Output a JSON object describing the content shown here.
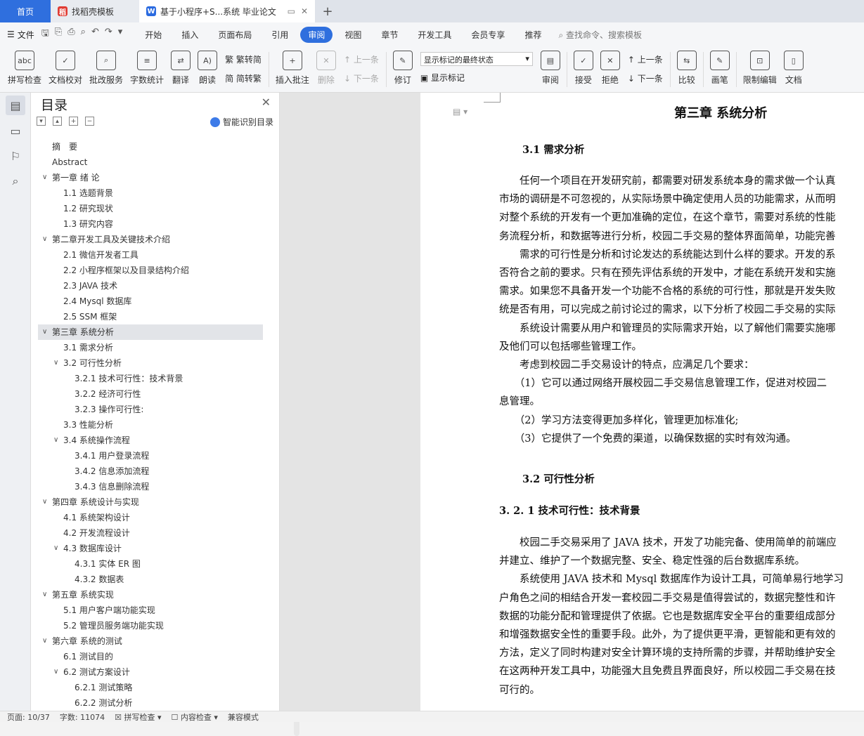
{
  "tabs": {
    "home": "首页",
    "templates": "找稻壳模板",
    "doc": "基于小程序+S...系统 毕业论文"
  },
  "menu": {
    "file": "文件",
    "items": [
      "开始",
      "插入",
      "页面布局",
      "引用",
      "审阅",
      "视图",
      "章节",
      "开发工具",
      "会员专享",
      "推荐"
    ],
    "search": "查找命令、搜索模板"
  },
  "ribbon": {
    "spell_icon": "abc",
    "spell": "拼写检查",
    "proof": "文档校对",
    "batch": "批改服务",
    "count": "字数统计",
    "translate": "翻译",
    "read": "朗读",
    "trad": "繁转简",
    "simp": "简转繁",
    "insert_comment": "插入批注",
    "delete": "删除",
    "prev": "上一条",
    "next": "下一条",
    "track": "修订",
    "markup_select": "显示标记的最终状态",
    "show_markup": "显示标记",
    "review": "审阅",
    "accept": "接受",
    "reject": "拒绝",
    "prev2": "上一条",
    "next2": "下一条",
    "compare": "比较",
    "pen": "画笔",
    "restrict": "限制编辑",
    "doc_right": "文档"
  },
  "toc": {
    "title": "目录",
    "smart": "智能识别目录",
    "items": [
      {
        "text": "摘　要",
        "level": 1
      },
      {
        "text": "Abstract",
        "level": 1
      },
      {
        "text": "第一章  绪  论",
        "level": 1
      },
      {
        "text": "1.1 选题背景",
        "level": 2
      },
      {
        "text": "1.2 研究现状",
        "level": 2
      },
      {
        "text": "1.3 研究内容",
        "level": 2
      },
      {
        "text": "第二章开发工具及关键技术介绍",
        "level": 1
      },
      {
        "text": "2.1 微信开发者工具",
        "level": 2
      },
      {
        "text": "2.2 小程序框架以及目录结构介绍",
        "level": 2
      },
      {
        "text": "2.3 JAVA 技术",
        "level": 2
      },
      {
        "text": "2.4    Mysql 数据库",
        "level": 2
      },
      {
        "text": "2.5 SSM 框架",
        "level": 2
      },
      {
        "text": "第三章  系统分析",
        "level": 1
      },
      {
        "text": "3.1 需求分析",
        "level": 2
      },
      {
        "text": "3.2 可行性分析",
        "level": 2
      },
      {
        "text": "3.2.1 技术可行性：技术背景",
        "level": 3
      },
      {
        "text": "3.2.2 经济可行性",
        "level": 3
      },
      {
        "text": "3.2.3 操作可行性:",
        "level": 3
      },
      {
        "text": "3.3 性能分析",
        "level": 2
      },
      {
        "text": "3.4 系统操作流程",
        "level": 2
      },
      {
        "text": "3.4.1 用户登录流程",
        "level": 3
      },
      {
        "text": "3.4.2 信息添加流程",
        "level": 3
      },
      {
        "text": "3.4.3 信息删除流程",
        "level": 3
      },
      {
        "text": "第四章  系统设计与实现",
        "level": 1
      },
      {
        "text": "4.1 系统架构设计",
        "level": 2
      },
      {
        "text": "4.2 开发流程设计",
        "level": 2
      },
      {
        "text": "4.3 数据库设计",
        "level": 2
      },
      {
        "text": "4.3.1 实体 ER 图",
        "level": 3
      },
      {
        "text": "4.3.2 数据表",
        "level": 3
      },
      {
        "text": "第五章  系统实现",
        "level": 1
      },
      {
        "text": "5.1 用户客户端功能实现",
        "level": 2
      },
      {
        "text": "5.2  管理员服务端功能实现",
        "level": 2
      },
      {
        "text": "第六章    系统的测试",
        "level": 1
      },
      {
        "text": "6.1  测试目的",
        "level": 2
      },
      {
        "text": "6.2  测试方案设计",
        "level": 2
      },
      {
        "text": "6.2.1  测试策略",
        "level": 3
      },
      {
        "text": "6.2.2  测试分析",
        "level": 3
      }
    ]
  },
  "page": {
    "chapter": "第三章  系统分析",
    "s31": "3.1 需求分析",
    "lines": [
      "　　任何一个项目在开发研究前，都需要对研发系统本身的需求做一个认真",
      "市场的调研是不可忽视的，从实际场景中确定使用人员的功能需求，从而明",
      "对整个系统的开发有一个更加准确的定位，在这个章节，需要对系统的性能",
      "务流程分析，和数据等进行分析，校园二手交易的整体界面简单，功能完善",
      "　　需求的可行性是分析和讨论发达的系统能达到什么样的要求。开发的系",
      "否符合之前的要求。只有在预先评估系统的开发中，才能在系统开发和实施",
      "需求。如果您不具备开发一个功能不合格的系统的可行性，那就是开发失败",
      "统是否有用，可以完成之前讨论过的需求，以下分析了校园二手交易的实际",
      "　　系统设计需要从用户和管理员的实际需求开始，以了解他们需要实施哪",
      "及他们可以包括哪些管理工作。",
      "　　考虑到校园二手交易设计的特点，应满足几个要求：",
      "　　（1）它可以通过网络开展校园二手交易信息管理工作，促进对校园二",
      "息管理。",
      "　　（2）学习方法变得更加多样化，管理更加标准化;",
      "　　（3）它提供了一个免费的渠道，以确保数据的实时有效沟通。"
    ],
    "s32": "3.2 可行性分析",
    "s321": "3. 2. 1 技术可行性：技术背景",
    "lines2": [
      "　　校园二手交易采用了 JAVA 技术，开发了功能完备、使用简单的前端应",
      "并建立、维护了一个数据完整、安全、稳定性强的后台数据库系统。",
      "　　系统使用 JAVA 技术和 Mysql 数据库作为设计工具，可简单易行地学习",
      "户角色之间的相结合开发一套校园二手交易是值得尝试的，数据完整性和许",
      "数据的功能分配和管理提供了依据。它也是数据库安全平台的重要组成部分",
      "和增强数据安全性的重要手段。此外，为了提供更平滑，更智能和更有效的",
      "方法，定义了同时构建对安全计算环境的支持所需的步骤，并帮助维护安全",
      "在这两种开发工具中，功能强大且免费且界面良好，所以校园二手交易在技",
      "可行的。"
    ]
  },
  "status": {
    "page": "页面: 10/37",
    "words": "字数: 11074",
    "spell": "拼写检查",
    "content": "内容检查",
    "mode": "兼容模式"
  }
}
